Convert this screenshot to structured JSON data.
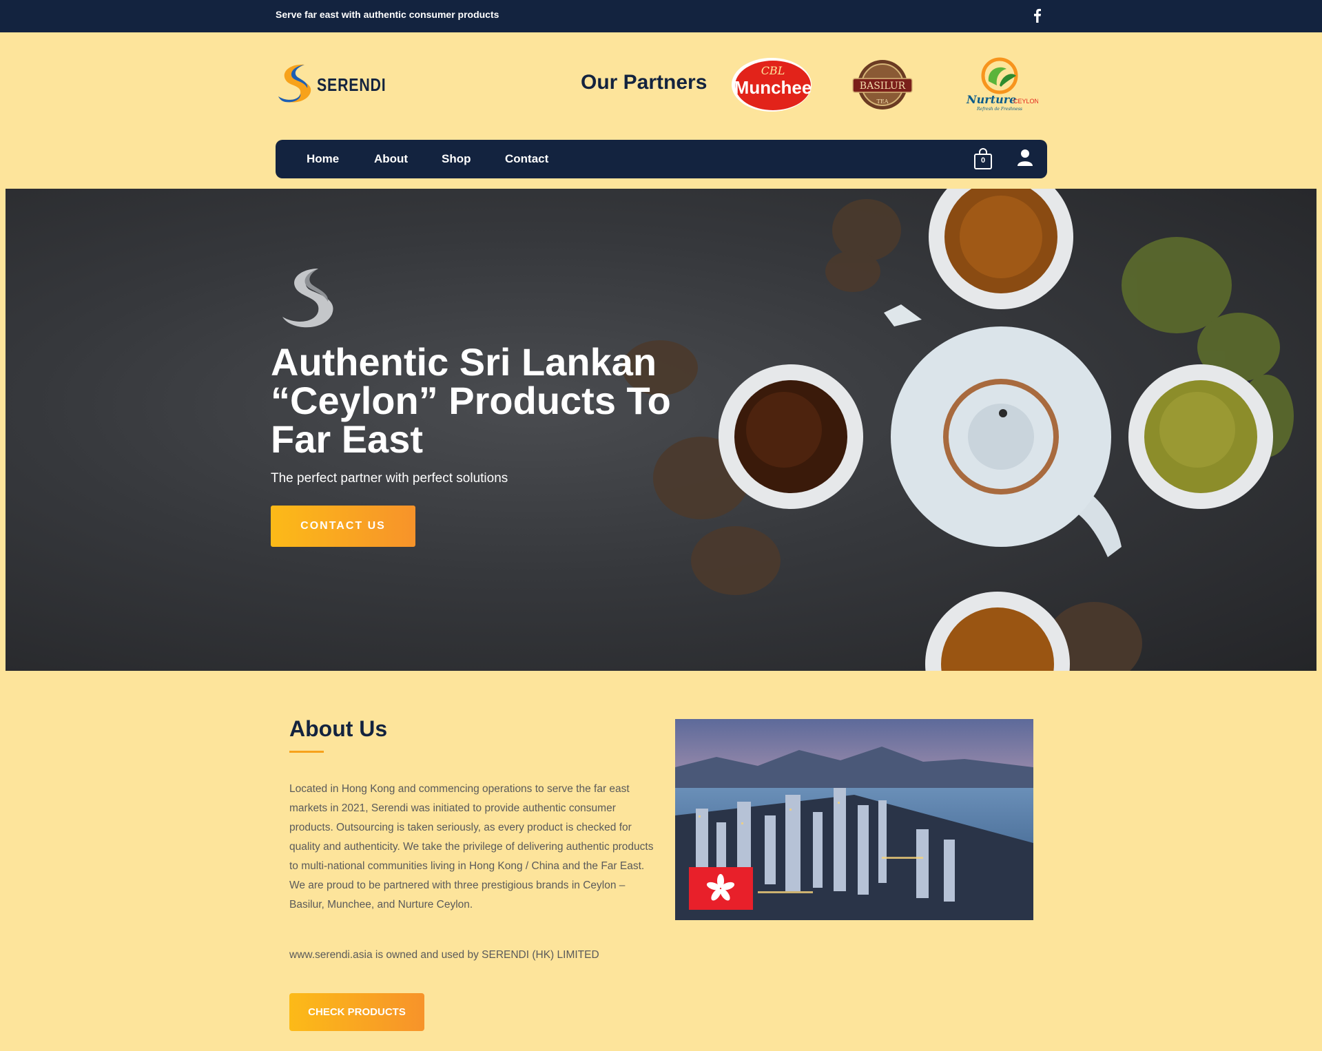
{
  "topbar": {
    "tagline": "Serve far east with authentic consumer products",
    "social_icon": "facebook-icon"
  },
  "brand": {
    "name": "SERENDI",
    "colors": {
      "navy": "#13233f",
      "cream": "#fde49b",
      "orange": "#f7932a",
      "yellow": "#fcba18"
    }
  },
  "partners": {
    "title": "Our Partners",
    "logos": [
      {
        "name": "Munchee",
        "lines": [
          "CBL",
          "Munchee"
        ]
      },
      {
        "name": "Basilur",
        "lines": [
          "BASILUR",
          "TEA"
        ]
      },
      {
        "name": "Nurture Ceylon",
        "lines": [
          "Nurture",
          "CEYLON",
          "Refresh de Freshness"
        ]
      }
    ]
  },
  "nav": {
    "items": [
      {
        "label": "Home"
      },
      {
        "label": "About"
      },
      {
        "label": "Shop"
      },
      {
        "label": "Contact"
      }
    ],
    "cart_count": "0",
    "cart_icon": "shopping-bag-icon",
    "user_icon": "user-icon"
  },
  "hero": {
    "heading": "Authentic Sri Lankan “Ceylon” Products To Far East",
    "subheading": "The perfect partner with perfect solutions",
    "cta_label": "CONTACT US"
  },
  "about": {
    "title": "About Us",
    "body": "Located in Hong Kong and commencing operations to serve the far east markets in 2021, Serendi was initiated to provide authentic consumer products. Outsourcing is taken seriously, as every product is checked for quality and authenticity. We take the privilege of delivering authentic products to multi-national communities living in Hong Kong / China and the Far East. We are proud to be partnered with three prestigious brands in Ceylon – Basilur, Munchee, and Nurture Ceylon.",
    "owner_line": "www.serendi.asia is owned and used by SERENDI (HK) LIMITED",
    "button_label": "CHECK PRODUCTS"
  }
}
